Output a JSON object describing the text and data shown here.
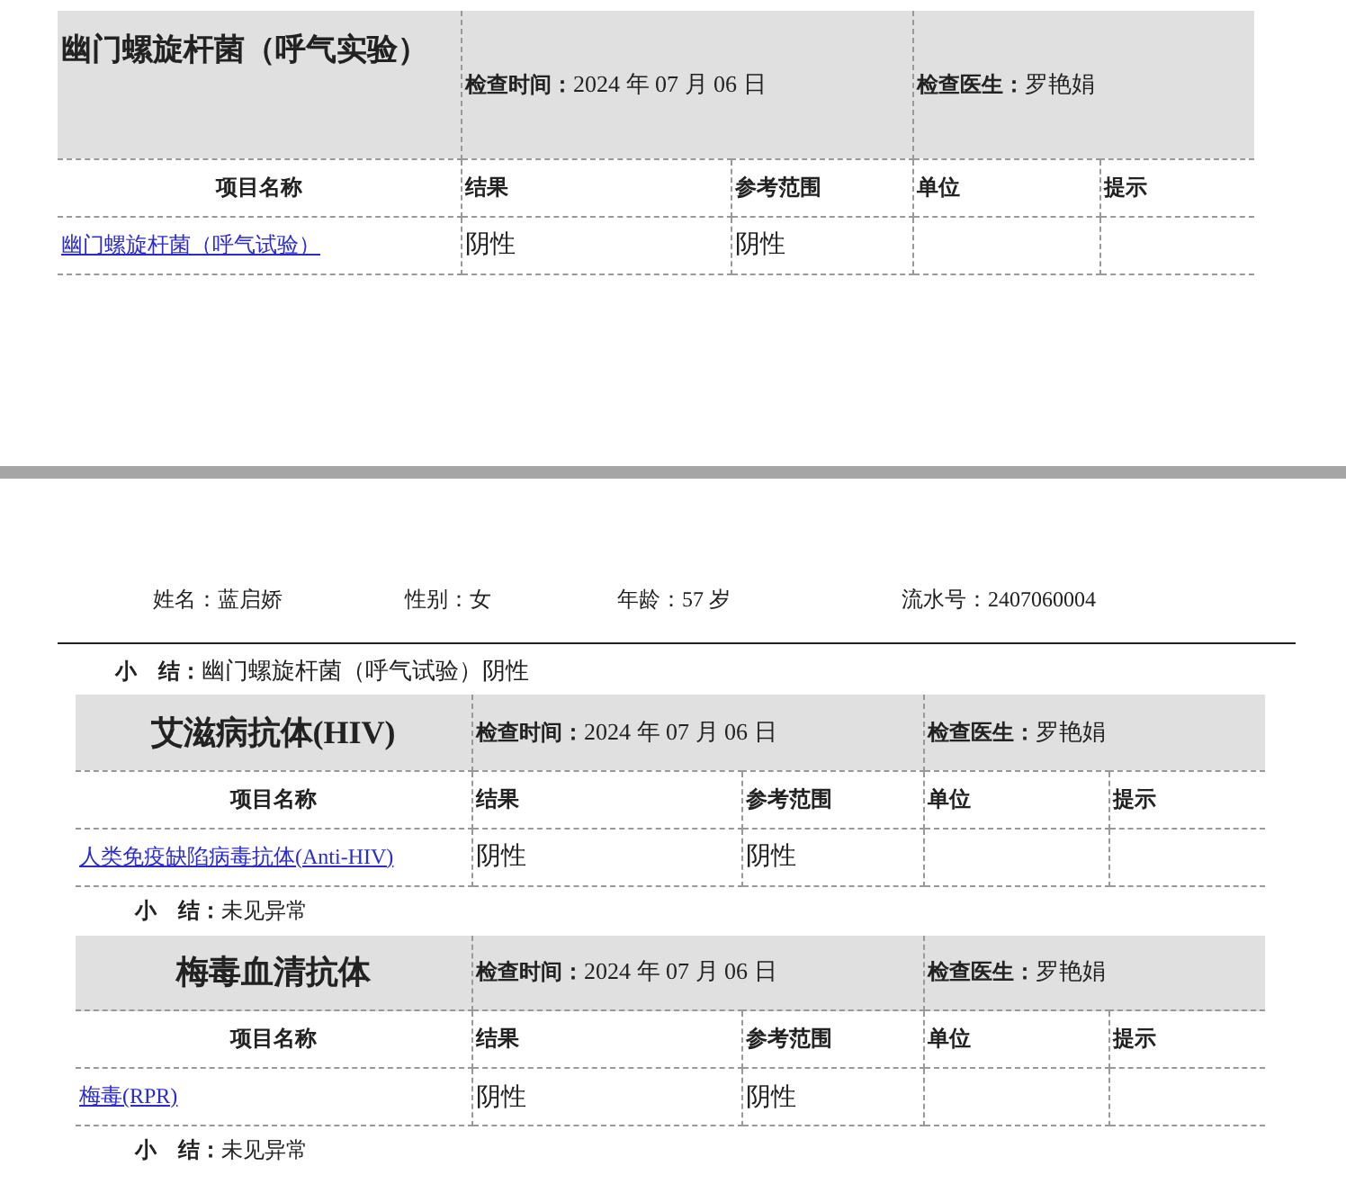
{
  "pages": [
    {
      "kind": "continued",
      "sections": [
        {
          "title": "幽门螺旋杆菌（呼气实验）",
          "exam_time_label": "检查时间：",
          "exam_time": "2024 年 07 月 06 日",
          "doctor_label": "检查医生：",
          "doctor": "罗艳娟",
          "columns": [
            "项目名称",
            "结果",
            "参考范围",
            "单位",
            "提示"
          ],
          "rows": [
            {
              "name": "幽门螺旋杆菌（呼气试验）",
              "result": "阴性",
              "range": "阴性"
            }
          ]
        }
      ]
    },
    {
      "kind": "full",
      "patient": [
        {
          "label": "姓名：",
          "value": "蓝启娇"
        },
        {
          "label": "性别：",
          "value": "女"
        },
        {
          "label": "年龄：",
          "value": "57 岁"
        },
        {
          "label": "流水号：",
          "value": "2407060004"
        }
      ],
      "summary": {
        "label": "小　结：",
        "text": "幽门螺旋杆菌（呼气试验）阴性"
      },
      "sections": [
        {
          "title": "艾滋病抗体(HIV)",
          "exam_time_label": "检查时间：",
          "exam_time": "2024 年 07 月 06 日",
          "doctor_label": "检查医生：",
          "doctor": "罗艳娟",
          "columns": [
            "项目名称",
            "结果",
            "参考范围",
            "单位",
            "提示"
          ],
          "rows": [
            {
              "name": "人类免疫缺陷病毒抗体(Anti-HIV)",
              "result": "阴性",
              "range": "阴性"
            }
          ],
          "summary": {
            "label": "小　结：",
            "text": "未见异常"
          }
        },
        {
          "title": "梅毒血清抗体",
          "exam_time_label": "检查时间：",
          "exam_time": "2024 年 07 月 06 日",
          "doctor_label": "检查医生：",
          "doctor": "罗艳娟",
          "columns": [
            "项目名称",
            "结果",
            "参考范围",
            "单位",
            "提示"
          ],
          "rows": [
            {
              "name": "梅毒(RPR)",
              "result": "阴性",
              "range": "阴性"
            }
          ],
          "summary": {
            "label": "小　结：",
            "text": "未见异常"
          }
        }
      ]
    }
  ]
}
